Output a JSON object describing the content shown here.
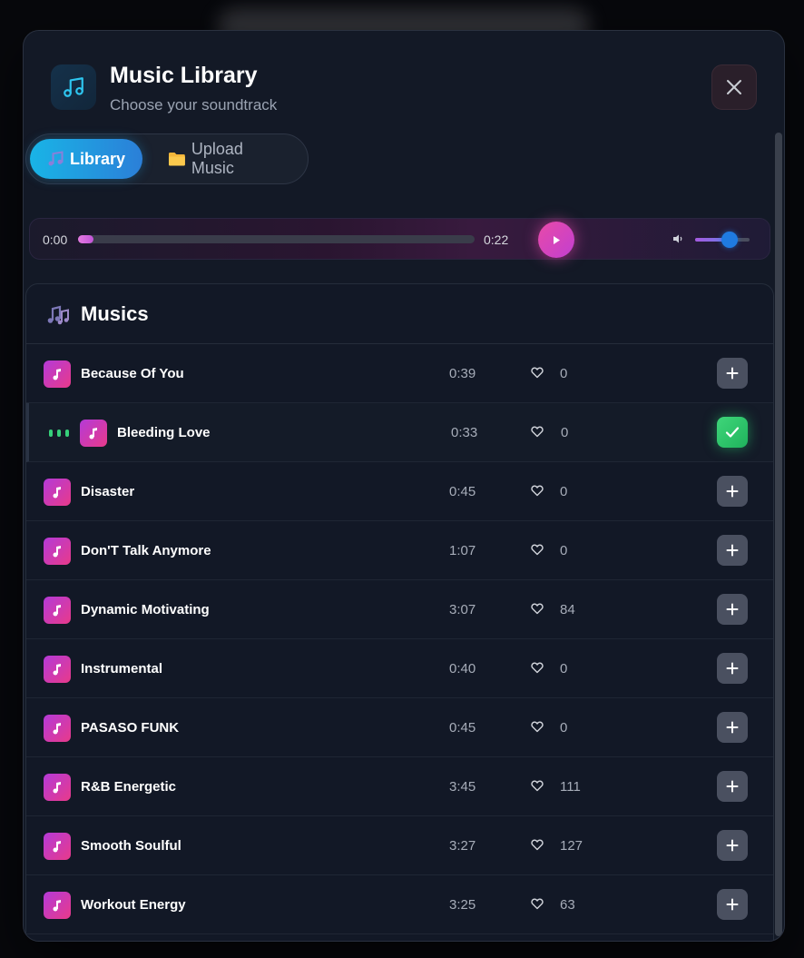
{
  "header": {
    "title": "Music Library",
    "subtitle": "Choose your soundtrack",
    "icon": "music-note-icon",
    "close_icon": "close-icon"
  },
  "tabs": [
    {
      "label": "Library",
      "icon": "music-notes-icon",
      "active": true
    },
    {
      "label": "Upload Music",
      "icon": "folder-icon",
      "active": false
    }
  ],
  "player": {
    "current_time": "0:00",
    "total_time": "0:22",
    "progress": 0.02,
    "volume": 0.63,
    "play_icon": "play-icon",
    "volume_icon": "volume-icon"
  },
  "library": {
    "title": "Musics",
    "tracks": [
      {
        "name": "Because Of You",
        "duration": "0:39",
        "likes": "0",
        "playing": false,
        "selected": false
      },
      {
        "name": "Bleeding Love",
        "duration": "0:33",
        "likes": "0",
        "playing": true,
        "selected": true
      },
      {
        "name": "Disaster",
        "duration": "0:45",
        "likes": "0",
        "playing": false,
        "selected": false
      },
      {
        "name": "Don'T Talk Anymore",
        "duration": "1:07",
        "likes": "0",
        "playing": false,
        "selected": false
      },
      {
        "name": "Dynamic Motivating",
        "duration": "3:07",
        "likes": "84",
        "playing": false,
        "selected": false
      },
      {
        "name": "Instrumental",
        "duration": "0:40",
        "likes": "0",
        "playing": false,
        "selected": false
      },
      {
        "name": "PASASO FUNK",
        "duration": "0:45",
        "likes": "0",
        "playing": false,
        "selected": false
      },
      {
        "name": "R&B Energetic",
        "duration": "3:45",
        "likes": "111",
        "playing": false,
        "selected": false
      },
      {
        "name": "Smooth Soulful",
        "duration": "3:27",
        "likes": "127",
        "playing": false,
        "selected": false
      },
      {
        "name": "Workout Energy",
        "duration": "3:25",
        "likes": "63",
        "playing": false,
        "selected": false
      }
    ]
  },
  "colors": {
    "accent_cyan": "#19b4e6",
    "accent_pink": "#e84aa8",
    "selected_green": "#1fb35c"
  }
}
